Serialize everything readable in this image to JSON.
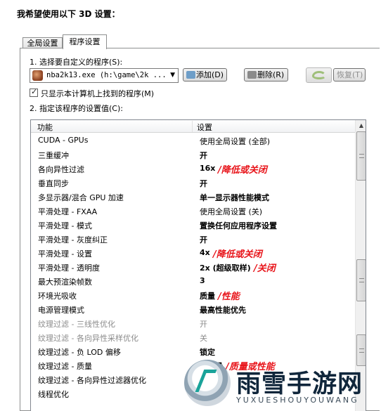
{
  "heading": "我希望使用以下 3D 设置：",
  "tabs": [
    {
      "label": "全局设置",
      "active": false
    },
    {
      "label": "程序设置",
      "active": true
    }
  ],
  "step1": {
    "label": "1. 选择要自定义的程序(S):",
    "program_value": "nba2k13.exe (h:\\game\\2k ...",
    "add_label": "添加(D)",
    "delete_label": "删除(R)",
    "restore_label": "恢复(T)",
    "show_only_label": "只显示本计算机上找到的程序(M)",
    "show_only_checked": true
  },
  "step2": {
    "label": "2. 指定该程序的设置值(C):",
    "columns": [
      "功能",
      "设置"
    ],
    "rows": [
      {
        "feature": "CUDA - GPUs",
        "value": "使用全局设置 (全部)",
        "bold": false,
        "grey": false,
        "note": ""
      },
      {
        "feature": "三重缓冲",
        "value": "开",
        "bold": true,
        "grey": false,
        "note": ""
      },
      {
        "feature": "各向异性过滤",
        "value": "16x",
        "bold": true,
        "grey": false,
        "note": "/降低或关闭"
      },
      {
        "feature": "垂直同步",
        "value": "开",
        "bold": true,
        "grey": false,
        "note": ""
      },
      {
        "feature": "多显示器/混合 GPU 加速",
        "value": "单一显示器性能模式",
        "bold": true,
        "grey": false,
        "note": ""
      },
      {
        "feature": "平滑处理 - FXAA",
        "value": "使用全局设置 (关)",
        "bold": false,
        "grey": false,
        "note": ""
      },
      {
        "feature": "平滑处理 - 模式",
        "value": "置换任何应用程序设置",
        "bold": true,
        "grey": false,
        "note": ""
      },
      {
        "feature": "平滑处理 - 灰度纠正",
        "value": "开",
        "bold": true,
        "grey": false,
        "note": ""
      },
      {
        "feature": "平滑处理 - 设置",
        "value": "4x",
        "bold": true,
        "grey": false,
        "note": "/降低或关闭"
      },
      {
        "feature": "平滑处理 - 透明度",
        "value": "2x (超级取样)",
        "bold": true,
        "grey": false,
        "note": "/关闭"
      },
      {
        "feature": "最大预渲染帧数",
        "value": "3",
        "bold": true,
        "grey": false,
        "note": ""
      },
      {
        "feature": "环境光吸收",
        "value": "质量",
        "bold": true,
        "grey": false,
        "note": "/性能"
      },
      {
        "feature": "电源管理模式",
        "value": "最高性能优先",
        "bold": true,
        "grey": false,
        "note": ""
      },
      {
        "feature": "纹理过滤 - 三线性优化",
        "value": "开",
        "bold": false,
        "grey": true,
        "note": ""
      },
      {
        "feature": "纹理过滤 - 各向异性采样优化",
        "value": "关",
        "bold": false,
        "grey": true,
        "note": ""
      },
      {
        "feature": "纹理过滤 - 负 LOD 偏移",
        "value": "锁定",
        "bold": true,
        "grey": false,
        "note": ""
      },
      {
        "feature": "纹理过滤 - 质量",
        "value": "高质量",
        "bold": true,
        "grey": false,
        "note": "/质量或性能"
      },
      {
        "feature": "纹理过滤 - 各向异性过滤器优化",
        "value": "",
        "bold": false,
        "grey": false,
        "note": ""
      },
      {
        "feature": "线程优化",
        "value": "开",
        "bold": true,
        "grey": false,
        "note": ""
      }
    ]
  },
  "watermark": {
    "title": "雨雪手游网",
    "subtitle": "YUXUESHOUYOUWANG"
  },
  "colors": {
    "note_red": "#e8141a",
    "nvidia_green": "#9fbf7a"
  }
}
